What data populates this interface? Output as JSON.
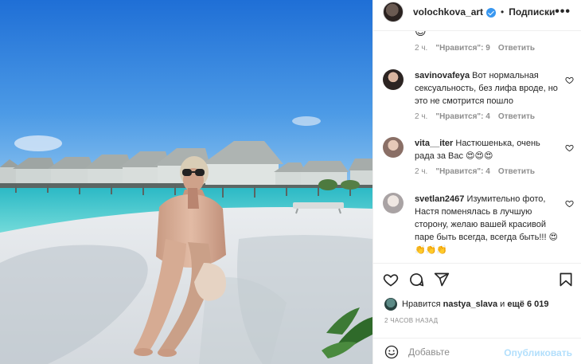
{
  "post": {
    "image_alt": "Beach photo"
  },
  "header": {
    "username": "volochkova_art",
    "separator": "•",
    "follow_label": "Подписки",
    "more_label": "•••"
  },
  "comments": {
    "top_peek": {
      "emoji": "😊",
      "time": "2 ч.",
      "likes": "\"Нравится\": 9",
      "reply": "Ответить"
    },
    "items": [
      {
        "username": "savinovafeya",
        "text": "Вот нормальная сексуальность, без лифа вроде, но это не смотрится пошло",
        "time": "2 ч.",
        "likes": "\"Нравится\": 4",
        "reply": "Ответить"
      },
      {
        "username": "vita__iter",
        "text": "Настюшенька, очень рада за Вас 😍😍😍",
        "time": "2 ч.",
        "likes": "\"Нравится\": 4",
        "reply": "Ответить"
      },
      {
        "username": "svetlan2467",
        "text": "Изумительно фото, Настя поменялась в лучшую сторону, желаю вашей красивой паре быть всегда, всегда быть!!! 😍👏👏👏"
      }
    ]
  },
  "likes": {
    "prefix": "Нравится",
    "user": "nastya_slava",
    "middle": "и",
    "more": "ещё 6 019"
  },
  "timestamp": "2 ЧАСОВ НАЗАД",
  "add_comment": {
    "placeholder": "Добавьте",
    "publish_label": "Опубликовать"
  },
  "colors": {
    "verified": "#3897f0",
    "publish_disabled": "#b2dffc",
    "meta_gray": "#8e8e8e"
  }
}
